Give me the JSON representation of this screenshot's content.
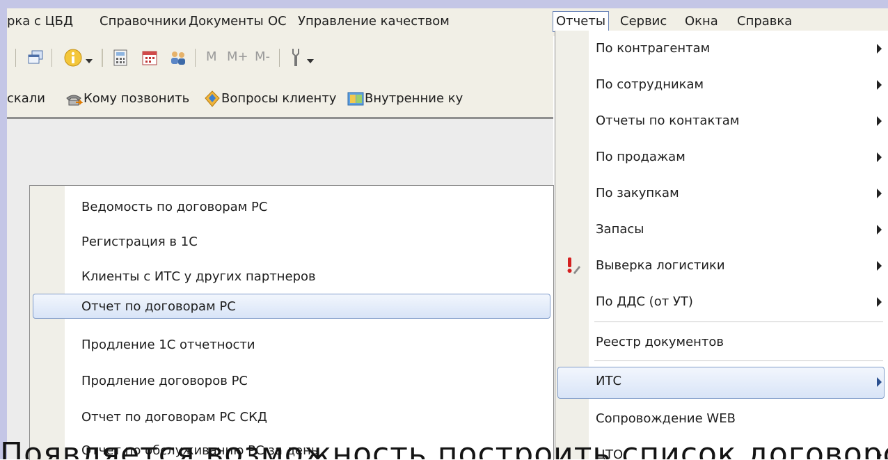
{
  "menubar": {
    "items": [
      "рка с ЦБД",
      "Справочники",
      "Документы",
      "ОС",
      "Управление качеством",
      "Отчеты",
      "Сервис",
      "Окна",
      "Справка"
    ]
  },
  "toolbar1": {
    "m_label": "M",
    "mplus_label": "M+",
    "mminus_label": "M-"
  },
  "toolbar2": {
    "items": [
      "скали",
      "Кому позвонить",
      "Вопросы клиенту",
      "Внутренние ку"
    ]
  },
  "submenu": {
    "items": [
      "Ведомость по договорам РС",
      "Регистрация в 1С",
      "Клиенты с ИТС у других партнеров",
      "Отчет по договорам РС",
      "Продление 1С отчетности",
      "Продление договоров РС",
      "Отчет по договорам РС СКД",
      "Отчет по обслуживанию РС за день"
    ],
    "selected_index": 3
  },
  "reports_menu": {
    "items": [
      "По контрагентам",
      "По сотрудникам",
      "Отчеты по контактам",
      "По продажам",
      "По закупкам",
      "Запасы",
      "Выверка логистики",
      "По ДДС  (от УТ)",
      "Реестр документов",
      "ИТС",
      "Сопровождение WEB",
      "ЦТО"
    ],
    "selected_index": 9
  },
  "caption": "Появляется возможность построить список договоров и"
}
